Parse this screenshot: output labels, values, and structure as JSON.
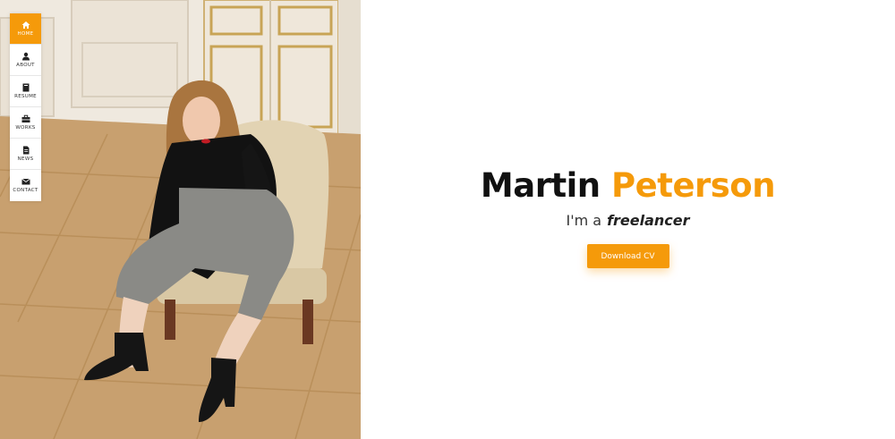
{
  "nav": {
    "items": [
      {
        "label": "HOME",
        "icon": "home-icon",
        "active": true
      },
      {
        "label": "ABOUT",
        "icon": "user-icon",
        "active": false
      },
      {
        "label": "RESUME",
        "icon": "book-icon",
        "active": false
      },
      {
        "label": "WORKS",
        "icon": "briefcase-icon",
        "active": false
      },
      {
        "label": "NEWS",
        "icon": "document-icon",
        "active": false
      },
      {
        "label": "CONTACT",
        "icon": "envelope-icon",
        "active": false
      }
    ]
  },
  "hero": {
    "first_name": "Martin",
    "last_name": "Peterson",
    "intro": "I'm a",
    "role": "freelancer",
    "cta_label": "Download CV"
  },
  "colors": {
    "accent": "#f59a0a",
    "text_dark": "#111111",
    "background": "#ffffff"
  }
}
